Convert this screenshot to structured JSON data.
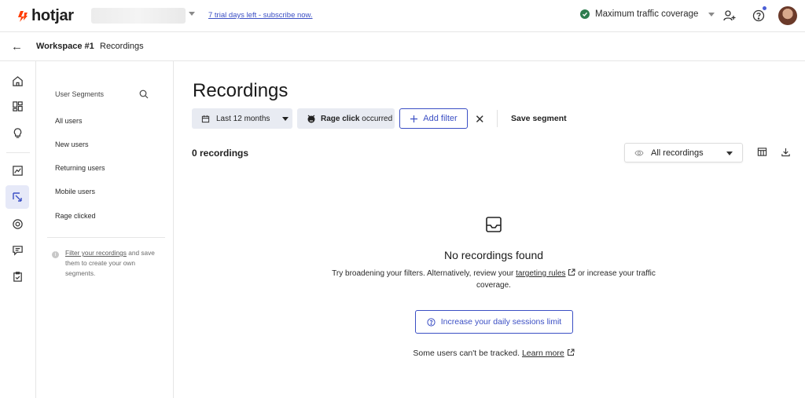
{
  "app": {
    "logo_text": "hotjar",
    "trial_link": "7 trial days left - subscribe now.",
    "traffic_status": "Maximum traffic coverage"
  },
  "breadcrumb": {
    "workspace": "Workspace #1",
    "page": "Recordings"
  },
  "rail": {
    "items": [
      "home-icon",
      "dashboard-icon",
      "lightbulb-icon",
      "trends-icon",
      "recordings-icon",
      "surveys-icon",
      "feedback-icon",
      "tasks-icon"
    ],
    "active": "recordings-icon"
  },
  "segments": {
    "title": "User Segments",
    "items": [
      {
        "label": "All users"
      },
      {
        "label": "New users"
      },
      {
        "label": "Returning users"
      },
      {
        "label": "Mobile users"
      },
      {
        "label": "Rage clicked"
      }
    ],
    "hint_link": "Filter your recordings",
    "hint_rest": " and save them to create your own segments."
  },
  "main": {
    "title": "Recordings",
    "filters": {
      "date_label": "Last 12 months",
      "rage_bold": "Rage click",
      "rage_rest": " occurred",
      "add_filter": "Add filter",
      "save_segment": "Save segment"
    },
    "count_label": "0 recordings",
    "view_select": "All recordings",
    "empty": {
      "title": "No recordings found",
      "desc_before": "Try broadening your filters. Alternatively, review your ",
      "desc_link": "targeting rules",
      "desc_after": " or increase your traffic coverage.",
      "button": "Increase your daily sessions limit",
      "tracked_text": "Some users can't be tracked. ",
      "tracked_link": "Learn more"
    }
  },
  "colors": {
    "brand": "#ff3c00",
    "accent": "#3b4fc4",
    "status_ok": "#2e7d4f",
    "chip_bg": "#e8ebf2"
  }
}
